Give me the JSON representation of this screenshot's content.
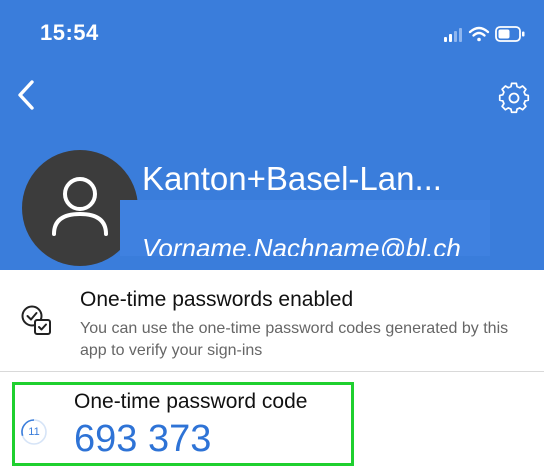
{
  "status_bar": {
    "time": "15:54",
    "icons": [
      "cellular-signal-icon",
      "wifi-icon",
      "battery-icon"
    ]
  },
  "nav": {
    "back_icon": "chevron-left-icon",
    "settings_icon": "gear-icon"
  },
  "account": {
    "avatar_icon": "user-avatar-icon",
    "title": "Kanton+Basel-Lan...",
    "email": "Vorname.Nachname@bl.ch"
  },
  "otp_status": {
    "icon": "otp-checkmark-icon",
    "title": "One-time passwords enabled",
    "description": "You can use the one-time password codes generated by this app to verify your sign-ins"
  },
  "otp_code": {
    "label": "One-time password code",
    "code": "693 373",
    "countdown": "11"
  },
  "colors": {
    "header_bg": "#3a7ddb",
    "code_blue": "#2e73d6",
    "highlight_green": "#1fd02f",
    "avatar_bg": "#3c3c3c"
  }
}
